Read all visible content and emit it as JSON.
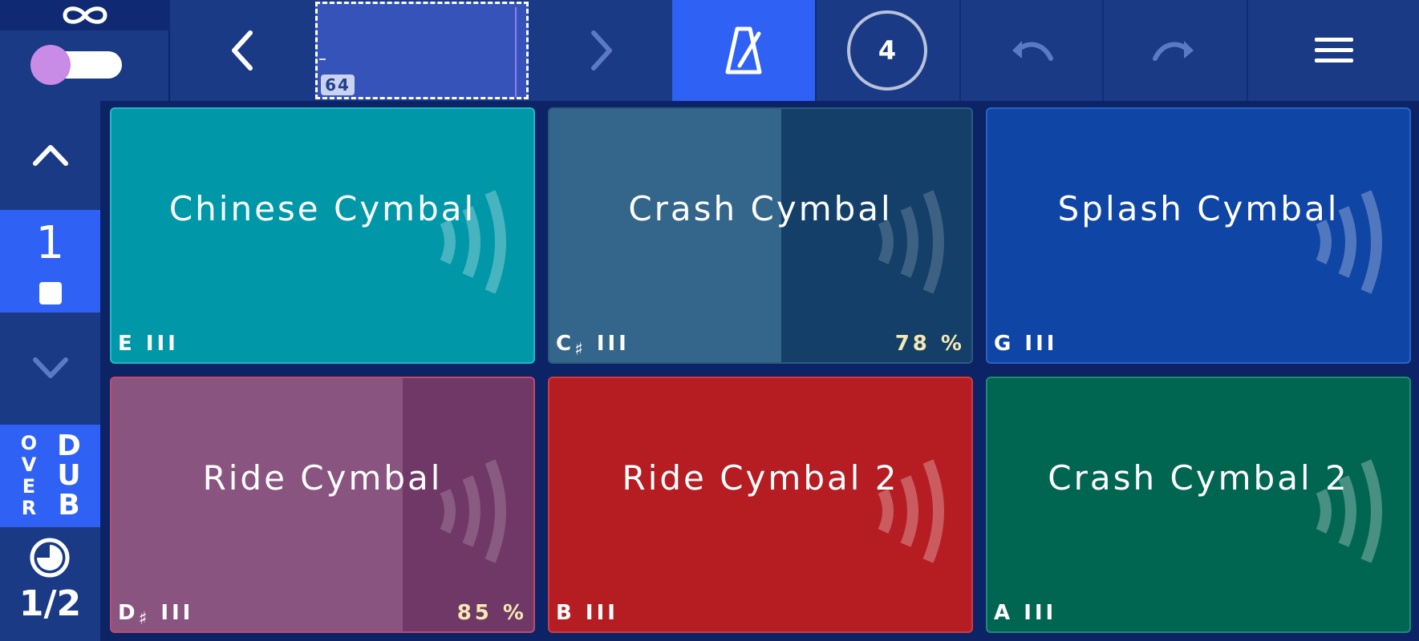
{
  "topbar": {
    "loop_icon": "infinity-icon",
    "toggle_state": "on",
    "prev_icon": "chevron-left-icon",
    "pattern_length": "64",
    "next_icon": "chevron-right-icon",
    "metronome_icon": "metronome-icon",
    "count_in": "4",
    "undo_icon": "undo-icon",
    "redo_icon": "redo-icon",
    "menu_icon": "hamburger-menu-icon"
  },
  "sidebar": {
    "up_icon": "chevron-up-icon",
    "bank_number": "1",
    "stop_icon": "stop-icon",
    "down_icon": "chevron-down-icon",
    "overdub_over": [
      "O",
      "V",
      "E",
      "R"
    ],
    "overdub_dub": [
      "D",
      "U",
      "B"
    ],
    "quantize_icon": "clock-icon",
    "quantize_value": "1/2"
  },
  "pads": [
    {
      "name": "Chinese Cymbal",
      "note": "E",
      "sharp": "",
      "bars": "III",
      "percent": "",
      "progress": 0,
      "color": "#0098a8"
    },
    {
      "name": "Crash Cymbal",
      "note": "C",
      "sharp": "♯",
      "bars": "III",
      "percent": "78 %",
      "progress": 0.55,
      "color": "#133f68"
    },
    {
      "name": "Splash Cymbal",
      "note": "G",
      "sharp": "",
      "bars": "III",
      "percent": "",
      "progress": 0,
      "color": "#0f45a5"
    },
    {
      "name": "Ride Cymbal",
      "note": "D",
      "sharp": "♯",
      "bars": "III",
      "percent": "85 %",
      "progress": 0.69,
      "color": "#703866"
    },
    {
      "name": "Ride Cymbal 2",
      "note": "B",
      "sharp": "",
      "bars": "III",
      "percent": "",
      "progress": 0,
      "color": "#b61d22"
    },
    {
      "name": "Crash Cymbal 2",
      "note": "A",
      "sharp": "",
      "bars": "III",
      "percent": "",
      "progress": 0,
      "color": "#006652"
    }
  ]
}
